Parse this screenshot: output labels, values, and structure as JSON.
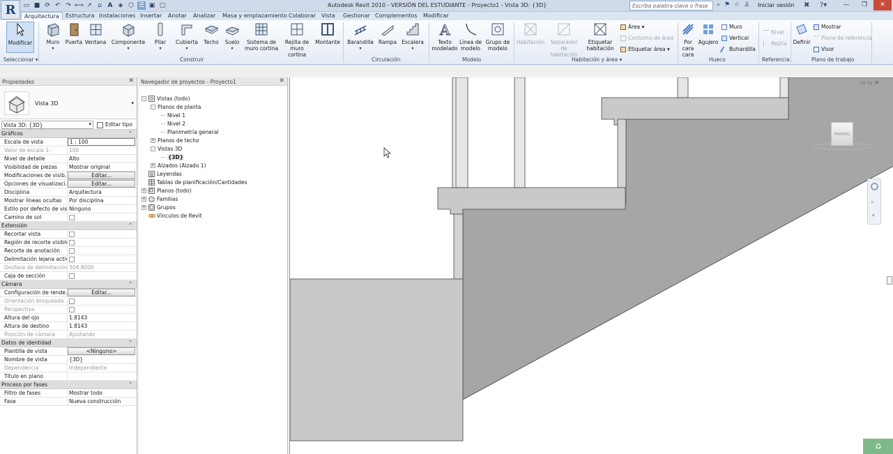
{
  "titlebar": {
    "app_button": "R",
    "title": "Autodesk Revit 2010 - VERSIÓN DEL ESTUDIANTE -   Proyecto1 - Vista 3D: {3D}",
    "search_placeholder": "Escriba palabra clave o frase",
    "login": "Iniciar sesión"
  },
  "tabs": [
    "Arquitectura",
    "Estructura",
    "Instalaciones",
    "Insertar",
    "Anotar",
    "Analizar",
    "Masa y emplazamiento",
    "Colaborar",
    "Vista",
    "Gestionar",
    "Complementos",
    "Modificar"
  ],
  "ribbon": {
    "modificar": "Modificar",
    "seleccionar": "Seleccionar ▾",
    "construir": {
      "label": "Construir",
      "items": [
        "Muro",
        "Puerta",
        "Ventana",
        "Componente",
        "Pilar",
        "Cubierta",
        "Techo",
        "Suelo",
        "Sistema de muro cortina",
        "Rejilla de muro cortina",
        "Montante"
      ]
    },
    "circulacion": {
      "label": "Circulación",
      "items": [
        "Barandilla",
        "Rampa",
        "Escalera"
      ]
    },
    "modelo": {
      "label": "Modelo",
      "items": [
        "Texto modelado",
        "Línea de modelo",
        "Grupo de modelo"
      ]
    },
    "habitacion": {
      "label": "Habitación y área ▾",
      "items": [
        "Habitación",
        "Separador de habitación",
        "Etiquetar habitación"
      ],
      "small": [
        "Área ▾",
        "Contorno de área",
        "Etiquetar área ▾"
      ]
    },
    "hueco": {
      "label": "Hueco",
      "items": [
        "Por cara",
        "Agujero"
      ],
      "small": [
        "Muro",
        "Vertical",
        "Buhardilla"
      ]
    },
    "referencia": {
      "label": "Referencia",
      "small": [
        "Nivel",
        "Rejilla"
      ]
    },
    "plano_trabajo": {
      "label": "Plano de trabajo",
      "items": [
        "Definir"
      ],
      "small": [
        "Mostrar",
        "Plano de referencia",
        "Visor"
      ]
    }
  },
  "properties": {
    "title": "Propiedades",
    "type_name": "Vista 3D",
    "selector": "Vista 3D: {3D}",
    "edit_type": "Editar tipo",
    "sections": [
      {
        "name": "Gráficos",
        "rows": [
          {
            "k": "Escala de vista",
            "v": "1 : 100",
            "kind": "input"
          },
          {
            "k": "Valor de escala    1:",
            "v": "100",
            "kind": "text",
            "disabled": true
          },
          {
            "k": "Nivel de detalle",
            "v": "Alto",
            "kind": "text"
          },
          {
            "k": "Visibilidad de piezas",
            "v": "Mostrar original",
            "kind": "text"
          },
          {
            "k": "Modificaciones de visib...",
            "v": "Editar...",
            "kind": "button"
          },
          {
            "k": "Opciones de visualizaci...",
            "v": "Editar...",
            "kind": "button"
          },
          {
            "k": "Disciplina",
            "v": "Arquitectura",
            "kind": "text"
          },
          {
            "k": "Mostrar líneas ocultas",
            "v": "Por disciplina",
            "kind": "text"
          },
          {
            "k": "Estilo por defecto de vis...",
            "v": "Ninguno",
            "kind": "text"
          },
          {
            "k": "Camino de sol",
            "v": "",
            "kind": "check"
          }
        ]
      },
      {
        "name": "Extensión",
        "rows": [
          {
            "k": "Recortar vista",
            "v": "",
            "kind": "check"
          },
          {
            "k": "Región de recorte visible",
            "v": "",
            "kind": "check"
          },
          {
            "k": "Recorte de anotación",
            "v": "",
            "kind": "check"
          },
          {
            "k": "Delimitación lejana activa",
            "v": "",
            "kind": "check"
          },
          {
            "k": "Desfase de delimitación...",
            "v": "304.8000",
            "kind": "text",
            "disabled": true
          },
          {
            "k": "Caja de sección",
            "v": "",
            "kind": "check"
          }
        ]
      },
      {
        "name": "Cámara",
        "rows": [
          {
            "k": "Configuración de rende...",
            "v": "Editar...",
            "kind": "button"
          },
          {
            "k": "Orientación bloqueada",
            "v": "",
            "kind": "check",
            "disabled": true
          },
          {
            "k": "Perspectiva",
            "v": "",
            "kind": "check",
            "disabled": true
          },
          {
            "k": "Altura del ojo",
            "v": "1.8143",
            "kind": "text"
          },
          {
            "k": "Altura de destino",
            "v": "1.8143",
            "kind": "text"
          },
          {
            "k": "Posición de cámara",
            "v": "Ajustando",
            "kind": "text",
            "disabled": true
          }
        ]
      },
      {
        "name": "Datos de identidad",
        "rows": [
          {
            "k": "Plantilla de vista",
            "v": "<Ninguno>",
            "kind": "button"
          },
          {
            "k": "Nombre de vista",
            "v": "{3D}",
            "kind": "text"
          },
          {
            "k": "Dependencia",
            "v": "Independiente",
            "kind": "text",
            "disabled": true
          },
          {
            "k": "Título en plano",
            "v": "",
            "kind": "text"
          }
        ]
      },
      {
        "name": "Proceso por fases",
        "rows": [
          {
            "k": "Filtro de fases",
            "v": "Mostrar todo",
            "kind": "text"
          },
          {
            "k": "Fase",
            "v": "Nueva construcción",
            "kind": "text"
          }
        ]
      }
    ]
  },
  "browser": {
    "title": "Navegador de proyectos - Proyecto1",
    "nodes": [
      {
        "label": "Vistas (todo)",
        "level": 0,
        "pm": "-",
        "icon": "views-icon"
      },
      {
        "label": "Planos de planta",
        "level": 1,
        "pm": "-"
      },
      {
        "label": "Nivel 1",
        "level": 2
      },
      {
        "label": "Nivel 2",
        "level": 2
      },
      {
        "label": "Planimetría general",
        "level": 2
      },
      {
        "label": "Planos de techo",
        "level": 1,
        "pm": "+"
      },
      {
        "label": "Vistas 3D",
        "level": 1,
        "pm": "-"
      },
      {
        "label": "{3D}",
        "level": 2,
        "bold": true
      },
      {
        "label": "Alzados (Alzado 1)",
        "level": 1,
        "pm": "+"
      },
      {
        "label": "Leyendas",
        "level": 0,
        "icon": "legend-icon"
      },
      {
        "label": "Tablas de planificación/Cantidades",
        "level": 0,
        "icon": "schedule-icon"
      },
      {
        "label": "Planos (todo)",
        "level": 0,
        "pm": "+",
        "icon": "sheet-icon"
      },
      {
        "label": "Familias",
        "level": 0,
        "pm": "+",
        "icon": "family-icon"
      },
      {
        "label": "Grupos",
        "level": 0,
        "pm": "+",
        "icon": "group-icon"
      },
      {
        "label": "Vínculos de Revit",
        "level": 0,
        "icon": "link-icon"
      }
    ]
  },
  "viewport": {
    "viewcube_face": "FRONTAL",
    "controls": "▭ ▭ ✕"
  },
  "colors": {
    "accent": "#cfe0f5",
    "titlebar": "#cfdbeb",
    "model_gray": "#c8c8c8",
    "model_dark": "#a6a6a6"
  }
}
